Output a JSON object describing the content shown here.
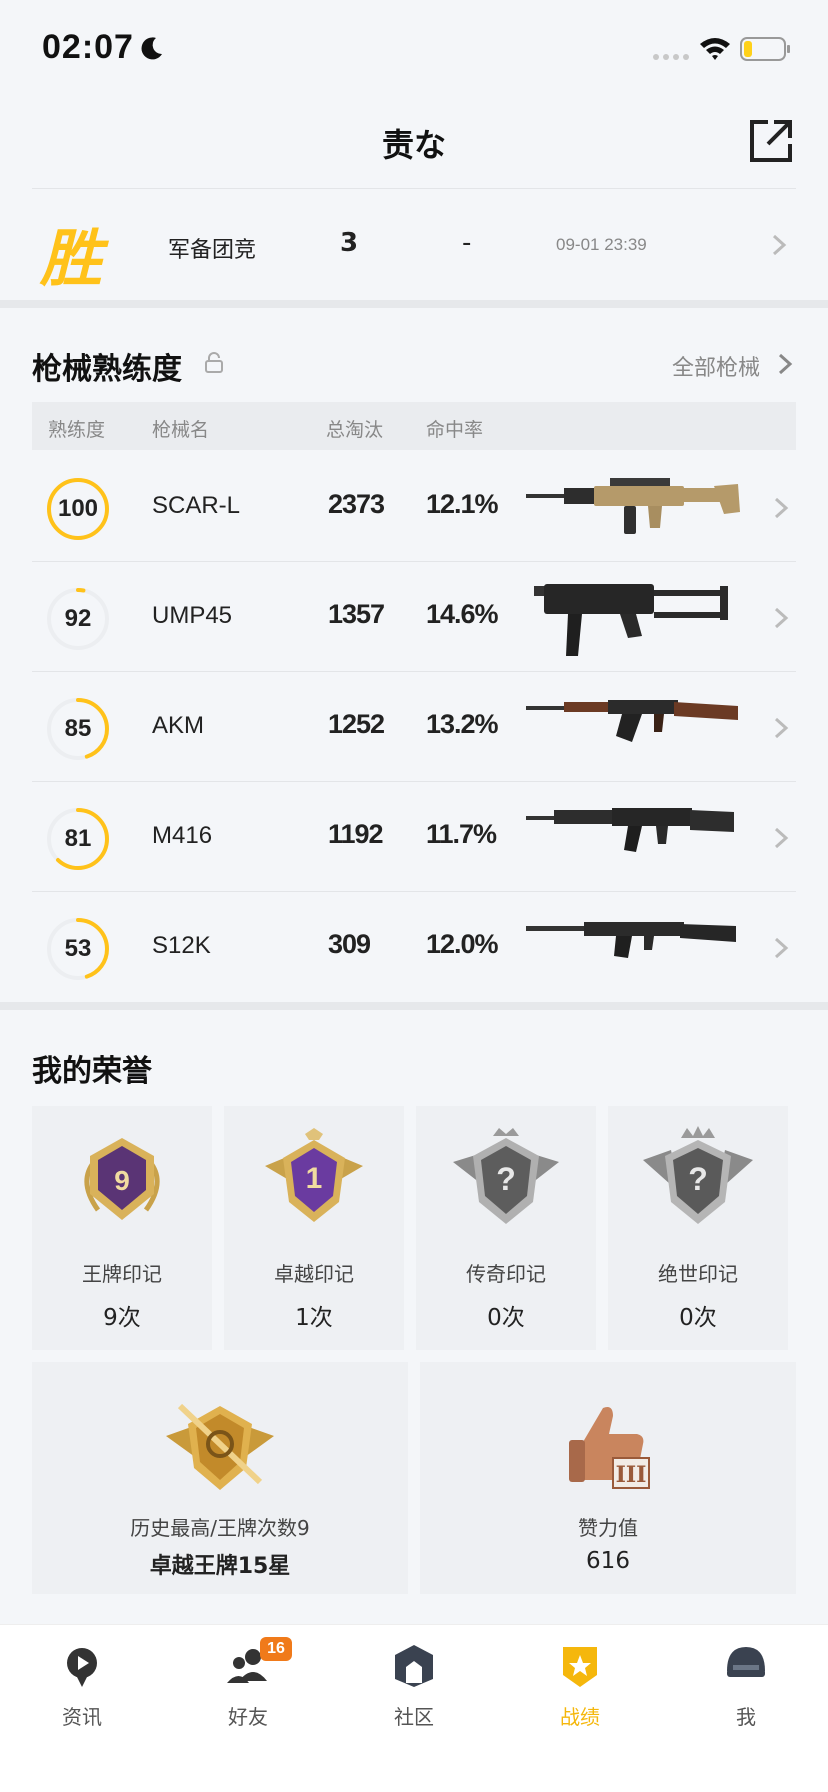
{
  "status": {
    "time": "02:07"
  },
  "header": {
    "title": "责な"
  },
  "match": {
    "result": "胜",
    "mode": "军备团竞",
    "kills": "3",
    "dash": "-",
    "time": "09-01 23:39"
  },
  "weapons": {
    "title": "枪械熟练度",
    "all_link": "全部枪械",
    "columns": {
      "mastery": "熟练度",
      "name": "枪械名",
      "kills": "总淘汰",
      "rate": "命中率"
    },
    "rows": [
      {
        "mastery": "100",
        "mastery_fraction": 1.0,
        "name": "SCAR-L",
        "kills": "2373",
        "rate": "12.1%"
      },
      {
        "mastery": "92",
        "mastery_fraction": 0.03,
        "name": "UMP45",
        "kills": "1357",
        "rate": "14.6%"
      },
      {
        "mastery": "85",
        "mastery_fraction": 0.45,
        "name": "AKM",
        "kills": "1252",
        "rate": "13.2%"
      },
      {
        "mastery": "81",
        "mastery_fraction": 0.62,
        "name": "M416",
        "kills": "1192",
        "rate": "11.7%"
      },
      {
        "mastery": "53",
        "mastery_fraction": 0.45,
        "name": "S12K",
        "kills": "309",
        "rate": "12.0%"
      }
    ]
  },
  "honors": {
    "title": "我的荣誉",
    "marks": [
      {
        "label": "王牌印记",
        "count": "9次",
        "emblem_number": "9",
        "icon": "ace-emblem-icon"
      },
      {
        "label": "卓越印记",
        "count": "1次",
        "emblem_number": "1",
        "icon": "excellence-emblem-icon"
      },
      {
        "label": "传奇印记",
        "count": "0次",
        "icon": "legend-emblem-locked-icon"
      },
      {
        "label": "绝世印记",
        "count": "0次",
        "icon": "peerless-emblem-locked-icon"
      }
    ],
    "best": {
      "label": "历史最高/王牌次数9",
      "value": "卓越王牌15星"
    },
    "likes": {
      "label": "赞力值",
      "value": "616"
    }
  },
  "tabs": [
    {
      "label": "资讯",
      "icon": "news-icon"
    },
    {
      "label": "好友",
      "icon": "friends-icon",
      "badge": "16"
    },
    {
      "label": "社区",
      "icon": "community-icon"
    },
    {
      "label": "战绩",
      "icon": "record-icon",
      "active": true
    },
    {
      "label": "我",
      "icon": "helmet-icon"
    }
  ],
  "colors": {
    "accent": "#ffc21a",
    "active_tab": "#f5b70c",
    "badge": "#f07a1a"
  }
}
